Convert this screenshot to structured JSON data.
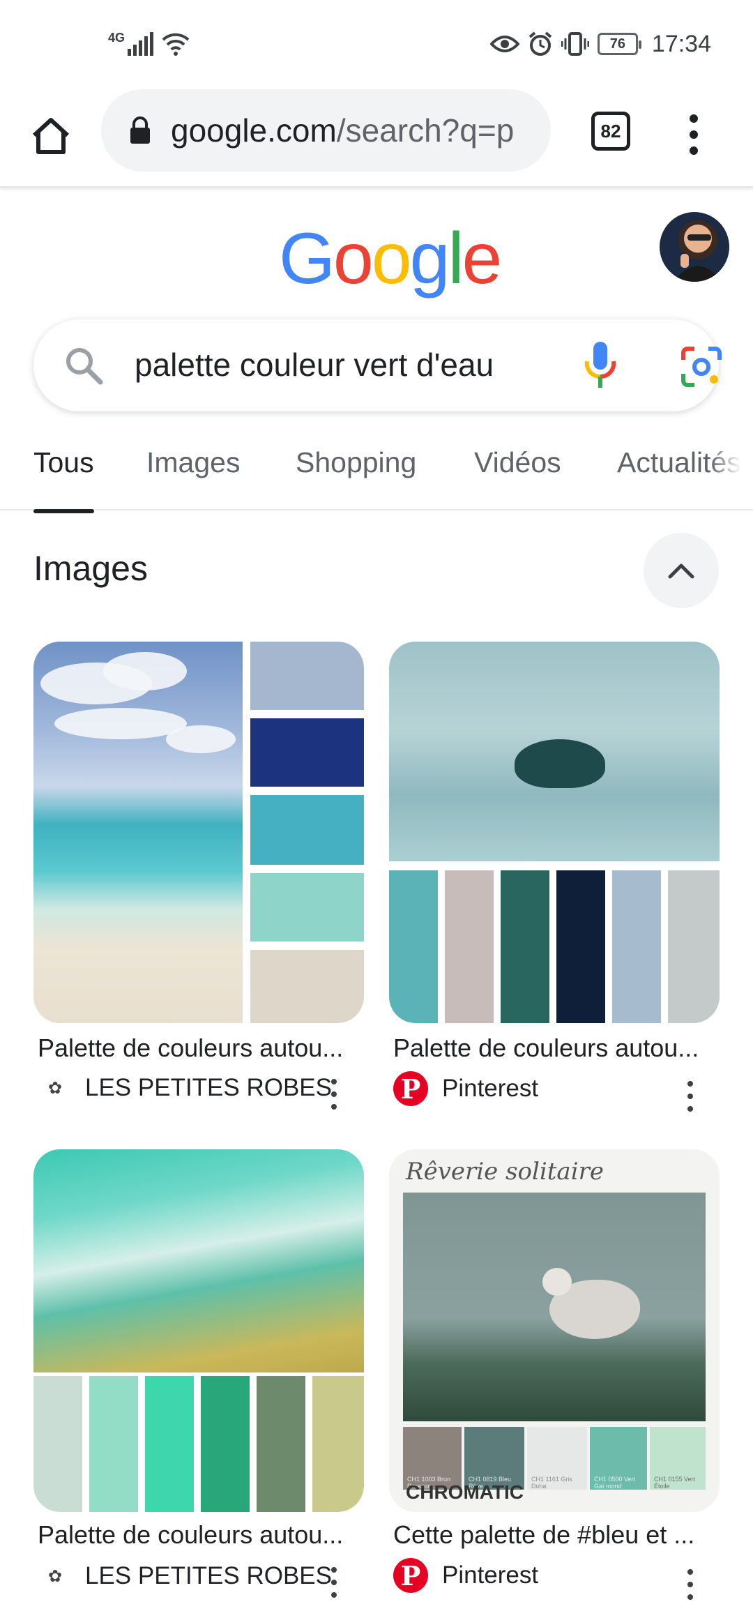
{
  "status_bar": {
    "network": "4G",
    "battery": "76",
    "time": "17:34"
  },
  "browser": {
    "url_host": "google.com",
    "url_path": "/search?q=p",
    "tab_count": "82"
  },
  "google": {
    "logo_letters": [
      "G",
      "o",
      "o",
      "g",
      "l",
      "e"
    ],
    "logo_colors": [
      "#4285F4",
      "#EA4335",
      "#FBBC05",
      "#4285F4",
      "#34A853",
      "#EA4335"
    ]
  },
  "search": {
    "query": "palette couleur vert d'eau"
  },
  "tabs": [
    {
      "label": "Tous"
    },
    {
      "label": "Images"
    },
    {
      "label": "Shopping"
    },
    {
      "label": "Vidéos"
    },
    {
      "label": "Actualités"
    }
  ],
  "section": {
    "title": "Images"
  },
  "results": [
    {
      "title": "Palette de couleurs autou...",
      "source": "LES PETITES ROBES"
    },
    {
      "title": "Palette de couleurs autou...",
      "source": "Pinterest"
    },
    {
      "title": "Palette de couleurs autou...",
      "source": "LES PETITES ROBES"
    },
    {
      "title": "Cette palette de #bleu et ...",
      "source": "Pinterest"
    }
  ],
  "image4": {
    "heading": "Rêverie solitaire",
    "brand": "CHROMATIC",
    "swatch_labels": [
      "CH1 1003 Brun Daragon",
      "CH1 0819 Bleu Rêve",
      "CH1 1161 Gris Doha",
      "CH1 0500 Vert Gaï mond",
      "CH1 0155 Vert Étoile"
    ]
  },
  "colors": {
    "accent": "#1a73e8",
    "pinterest": "#e60023",
    "palette1": [
      "#a5b6cf",
      "#1c3480",
      "#44b0c2",
      "#8fd4c8",
      "#ded6c8"
    ],
    "palette2": [
      "#5cb3b7",
      "#c8bcbb",
      "#2a6660",
      "#0f1f3a",
      "#a6bcce",
      "#c4c9c9"
    ],
    "palette3": [
      "#c9ddd4",
      "#93dcc6",
      "#3ed6ad",
      "#27a77a",
      "#6e8a6c",
      "#c8c98a"
    ],
    "palette4": [
      "#8c847c",
      "#5c7c7b",
      "#e5e8e6",
      "#6dbcab",
      "#bfe3cc"
    ]
  }
}
